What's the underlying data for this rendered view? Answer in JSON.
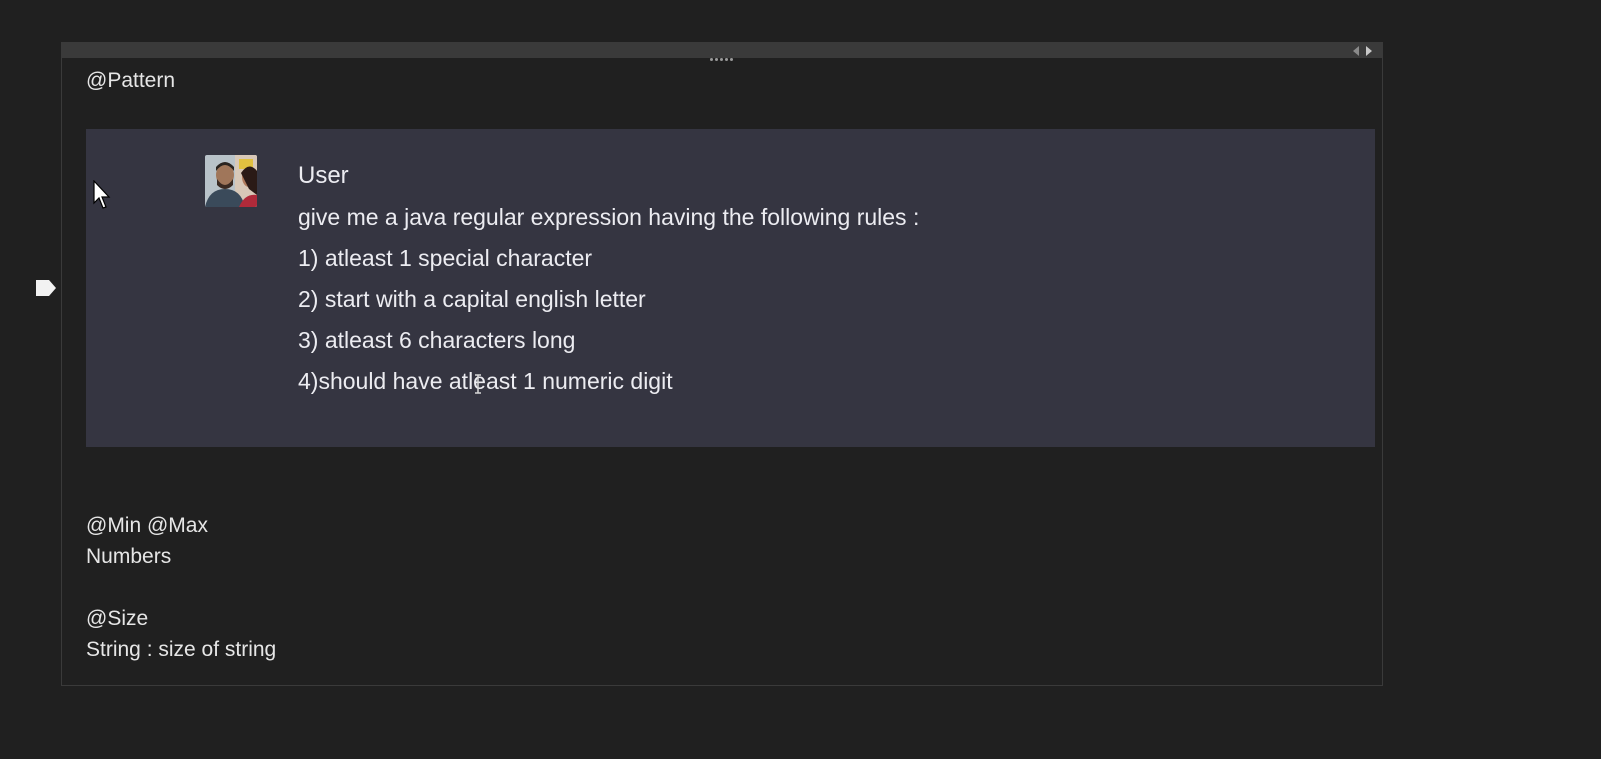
{
  "note": {
    "heading": "@Pattern",
    "chat": {
      "author": "User",
      "lines": [
        "give me a java regular expression having the following rules :",
        "1) atleast 1 special character",
        "2) start with a capital english letter",
        "3) atleast 6 characters long",
        "4)should have atleast 1 numeric digit"
      ]
    },
    "min_max": {
      "heading": "@Min @Max",
      "desc": "Numbers"
    },
    "size": {
      "heading": "@Size",
      "desc": "String : size of string"
    }
  },
  "colors": {
    "background": "#202020",
    "chat_panel": "#353541",
    "topbar": "#3a3a3a"
  },
  "icons": [
    "note-marker-icon",
    "drag-handle-icon",
    "arrow-left-icon",
    "arrow-right-icon",
    "avatar",
    "cursor-icon",
    "ibeam-cursor-icon"
  ]
}
